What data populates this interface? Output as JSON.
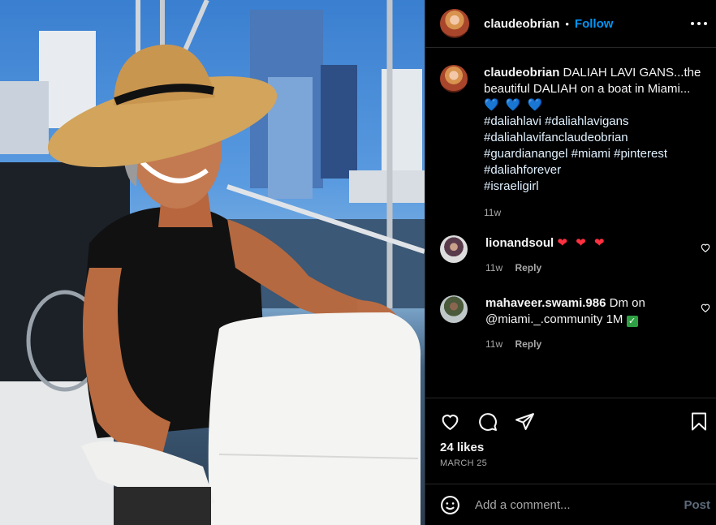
{
  "post": {
    "username": "claudeobrian",
    "follow_label": "Follow",
    "separator": "•",
    "caption_text": "DALIAH LAVI GANS...the beautiful DALIAH on a boat in Miami...",
    "caption_hearts": "💙 💙 💙",
    "hashtags": [
      "#daliahlavi",
      "#daliahlavigans",
      "#daliahlavifanclaudeobrian",
      "#guardianangel",
      "#miami",
      "#pinterest",
      "#daliahforever",
      "#israeligirl"
    ],
    "caption_time": "11w",
    "likes": "24 likes",
    "date": "MARCH 25"
  },
  "comments": [
    {
      "username": "lionandsoul",
      "text": "❤ ❤ ❤",
      "time": "11w",
      "reply": "Reply"
    },
    {
      "username": "mahaveer.swami.986",
      "text": "Dm on @miami._.community 1M",
      "check": "✓",
      "time": "11w",
      "reply": "Reply"
    }
  ],
  "composer": {
    "placeholder": "Add a comment...",
    "post_label": "Post"
  },
  "icons": [
    "more-icon",
    "heart-icon",
    "comment-icon",
    "share-icon",
    "save-icon",
    "emoji-icon"
  ],
  "colors": {
    "accent": "#0095f6",
    "background": "#000000",
    "muted": "#a8a8a8"
  }
}
